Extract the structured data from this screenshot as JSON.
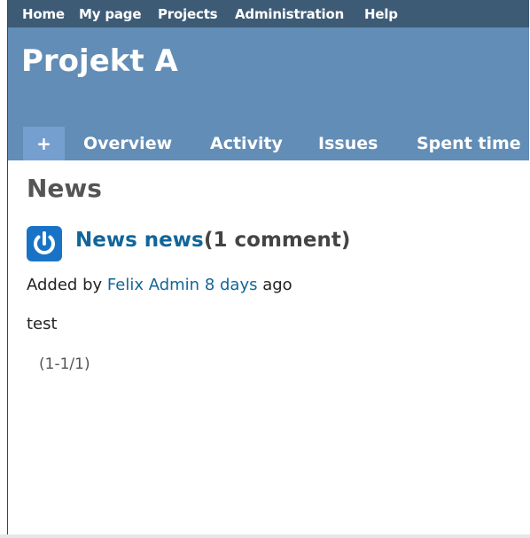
{
  "top_menu": {
    "home": "Home",
    "my_page": "My page",
    "projects": "Projects",
    "administration": "Administration",
    "help": "Help"
  },
  "project": {
    "title": "Projekt A"
  },
  "main_menu": {
    "new_label": "+",
    "tabs": [
      "Overview",
      "Activity",
      "Issues",
      "Spent time"
    ]
  },
  "page": {
    "heading": "News"
  },
  "news": {
    "icon": "power-icon",
    "title": "News news",
    "comments": "(1 comment)",
    "added_prefix": "Added by",
    "author": "Felix Admin",
    "age": "8 days",
    "age_suffix": "ago",
    "description": "test"
  },
  "pagination": {
    "label": "(1-1/1)"
  },
  "colors": {
    "top_menu_bg": "#3e5b76",
    "header_bg": "#628db6",
    "link": "#169",
    "icon_bg": "#1873c7"
  }
}
